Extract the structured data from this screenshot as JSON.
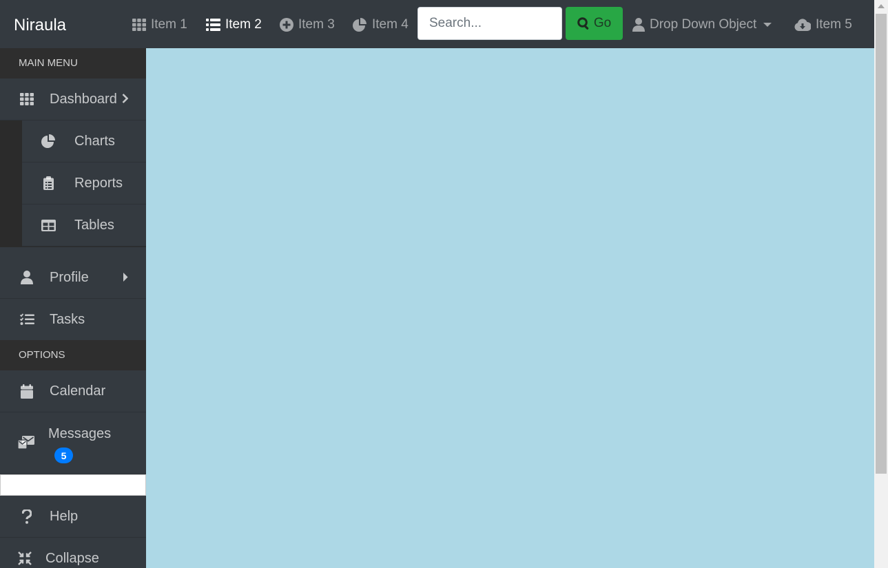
{
  "navbar": {
    "brand": "Niraula",
    "items": [
      {
        "label": "Item 1",
        "icon": "grid-icon"
      },
      {
        "label": "Item 2",
        "icon": "list-icon"
      },
      {
        "label": "Item 3",
        "icon": "plus-circle-icon"
      },
      {
        "label": "Item 4",
        "icon": "pie-chart-icon"
      }
    ],
    "search": {
      "placeholder": "Search...",
      "value": ""
    },
    "go_label": "Go",
    "dropdown_label": "Drop Down Object",
    "item5_label": "Item 5"
  },
  "sidebar": {
    "main_menu_header": "MAIN MENU",
    "dashboard": "Dashboard",
    "sub_items": [
      "Charts",
      "Reports",
      "Tables"
    ],
    "profile": "Profile",
    "tasks": "Tasks",
    "options_header": "OPTIONS",
    "calendar": "Calendar",
    "messages": "Messages",
    "messages_badge": "5",
    "help": "Help",
    "collapse": "Collapse"
  },
  "colors": {
    "navbar_bg": "#343a40",
    "content_bg": "#add8e6",
    "go_button": "#28a745",
    "badge": "#007bff"
  }
}
